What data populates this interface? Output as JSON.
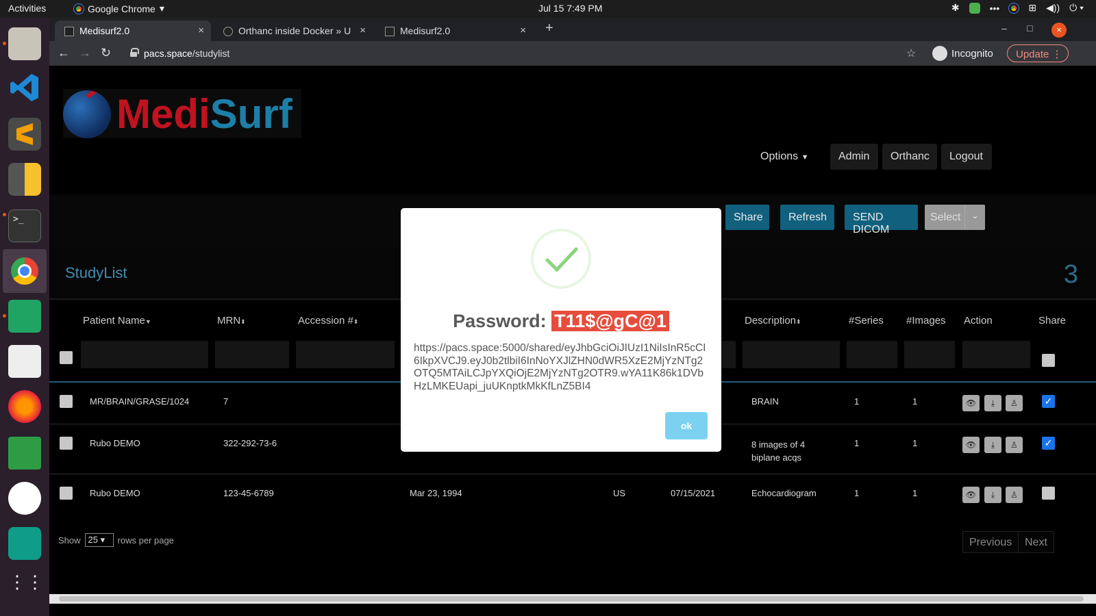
{
  "os": {
    "activities": "Activities",
    "app_name": "Google Chrome",
    "clock": "Jul 15  7:49 PM"
  },
  "browser": {
    "tabs": [
      {
        "title": "Medisurf2.0"
      },
      {
        "title": "Orthanc inside Docker » U"
      },
      {
        "title": "Medisurf2.0"
      }
    ],
    "url_host": "pacs.space",
    "url_path": "/studylist",
    "incognito_label": "Incognito",
    "update_label": "Update"
  },
  "header": {
    "logo_medi": "Medi",
    "logo_surf": "Surf",
    "options_label": "Options",
    "admin_label": "Admin",
    "orthanc_label": "Orthanc",
    "logout_label": "Logout"
  },
  "actions": {
    "share": "Share",
    "refresh": "Refresh",
    "send_dicom": "SEND DICOM",
    "select": "Select"
  },
  "studylist": {
    "title": "StudyList",
    "count": "3",
    "columns": {
      "patient_name": "Patient Name",
      "mrn": "MRN",
      "accession": "Accession #",
      "description": "Description",
      "series": "#Series",
      "images": "#Images",
      "action": "Action",
      "share": "Share"
    },
    "rows": [
      {
        "patient": "MR/BRAIN/GRASE/1024",
        "mrn": "7",
        "dob": "",
        "modality": "",
        "date": "",
        "description": "BRAIN",
        "series": "1",
        "images": "1",
        "shared": true
      },
      {
        "patient": "Rubo DEMO",
        "mrn": "322-292-73-6",
        "dob": "",
        "modality": "",
        "date": "",
        "description": "8 images of 4 biplane acqs",
        "series": "1",
        "images": "1",
        "shared": true
      },
      {
        "patient": "Rubo DEMO",
        "mrn": "123-45-6789",
        "dob": "Mar 23, 1994",
        "modality": "US",
        "date": "07/15/2021",
        "description": "Echocardiogram",
        "series": "1",
        "images": "1",
        "shared": false
      }
    ],
    "show_label": "Show",
    "rows_per_page": "25",
    "rows_per_page_label": "rows per page",
    "previous": "Previous",
    "next": "Next"
  },
  "modal": {
    "password_label": "Password:",
    "password": "T11$@gC@1",
    "share_url": "https://pacs.space:5000/shared/eyJhbGciOiJIUzI1NiIsInR5cCI6IkpXVCJ9.eyJ0b2tlbiI6InNoYXJlZHN0dWR5XzE2MjYzNTg2OTQ5MTAiLCJpYXQiOjE2MjYzNTg2OTR9.wYA11K86k1DVbHzLMKEUapi_juUKnptkMkKfLnZ5BI4",
    "ok_label": "ok"
  }
}
